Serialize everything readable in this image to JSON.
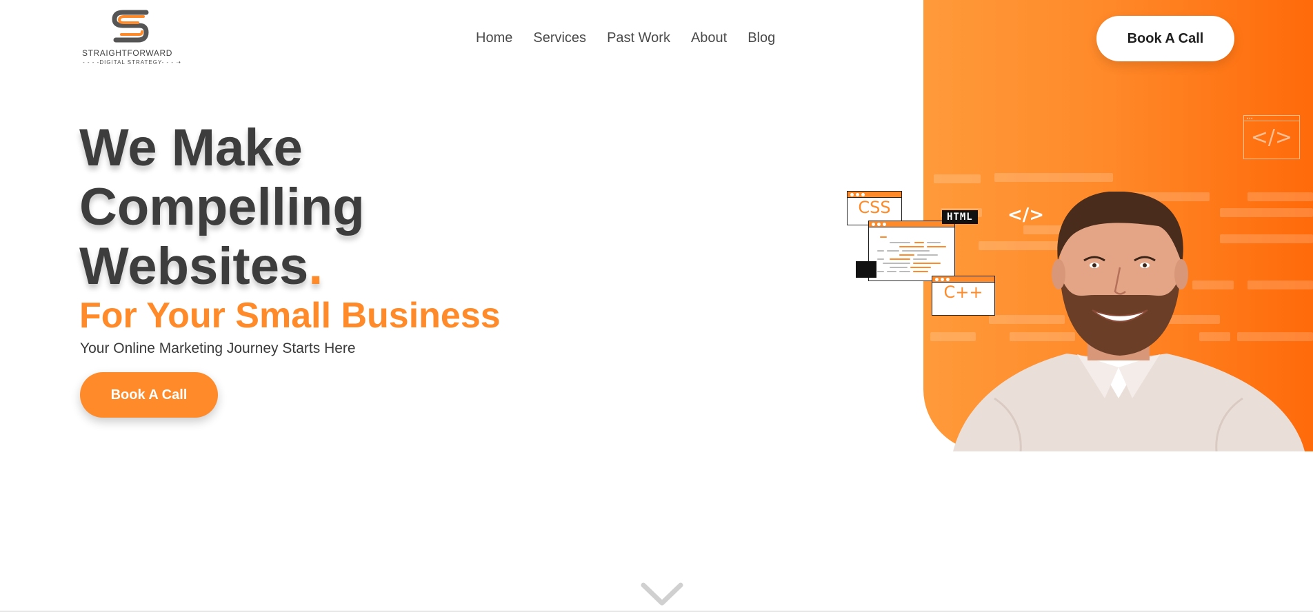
{
  "brand": {
    "name": "STRAIGHTFORWARD",
    "subline": "- - - -DIGITAL STRATEGY- - - ➝",
    "logo_icon": "s-logo-icon",
    "colors": {
      "accent": "#ff8a2a",
      "accent_dark": "#ff6a0a",
      "text": "#3d3d3d"
    }
  },
  "nav": {
    "items": [
      {
        "label": "Home"
      },
      {
        "label": "Services"
      },
      {
        "label": "Past Work"
      },
      {
        "label": "About"
      },
      {
        "label": "Blog"
      }
    ]
  },
  "header": {
    "cta_label": "Book A Call"
  },
  "hero": {
    "headline": [
      "We Make",
      "Compelling",
      "Websites"
    ],
    "headline_dot": ".",
    "subheadline": "For Your Small Business",
    "tagline": "Your Online Marketing Journey Starts Here",
    "cta_label": "Book A Call"
  },
  "illustration": {
    "css_label": "CSS",
    "html_label": "HTML",
    "cpp_label": "C++",
    "code_symbol": "</>",
    "panel_code_symbol": "</>",
    "panel_dots": "•••"
  },
  "icons": {
    "scroll": "chevron-down-icon",
    "code": "code-icon"
  }
}
